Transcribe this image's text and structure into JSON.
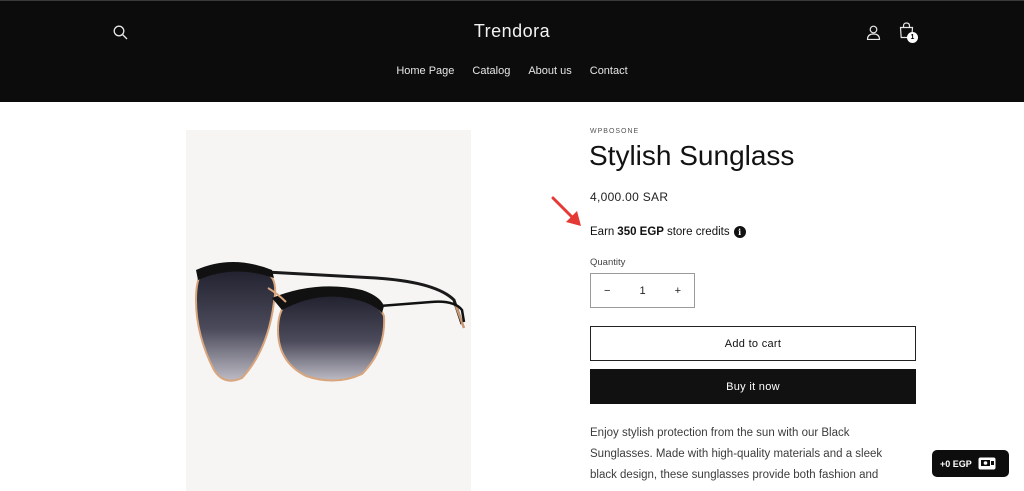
{
  "header": {
    "brand": "Trendora",
    "nav": [
      "Home Page",
      "Catalog",
      "About us",
      "Contact"
    ],
    "cart_count": "1"
  },
  "product": {
    "vendor": "WPBOSONE",
    "title": "Stylish Sunglass",
    "price": "4,000.00 SAR",
    "credits": {
      "prefix": "Earn",
      "amount": "350 EGP",
      "suffix": "store credits",
      "info": "i"
    },
    "quantity_label": "Quantity",
    "quantity": {
      "minus": "−",
      "value": "1",
      "plus": "+"
    },
    "add_to_cart": "Add to cart",
    "buy_now": "Buy it now",
    "description": "Enjoy stylish protection from the sun with our Black Sunglasses. Made with high-quality materials and a sleek black design, these sunglasses provide both fashion and"
  },
  "widget": {
    "label": "+0 EGP"
  },
  "colors": {
    "header_bg": "#0c0c0c",
    "arrow": "#e53935",
    "button_dark": "#111111"
  }
}
